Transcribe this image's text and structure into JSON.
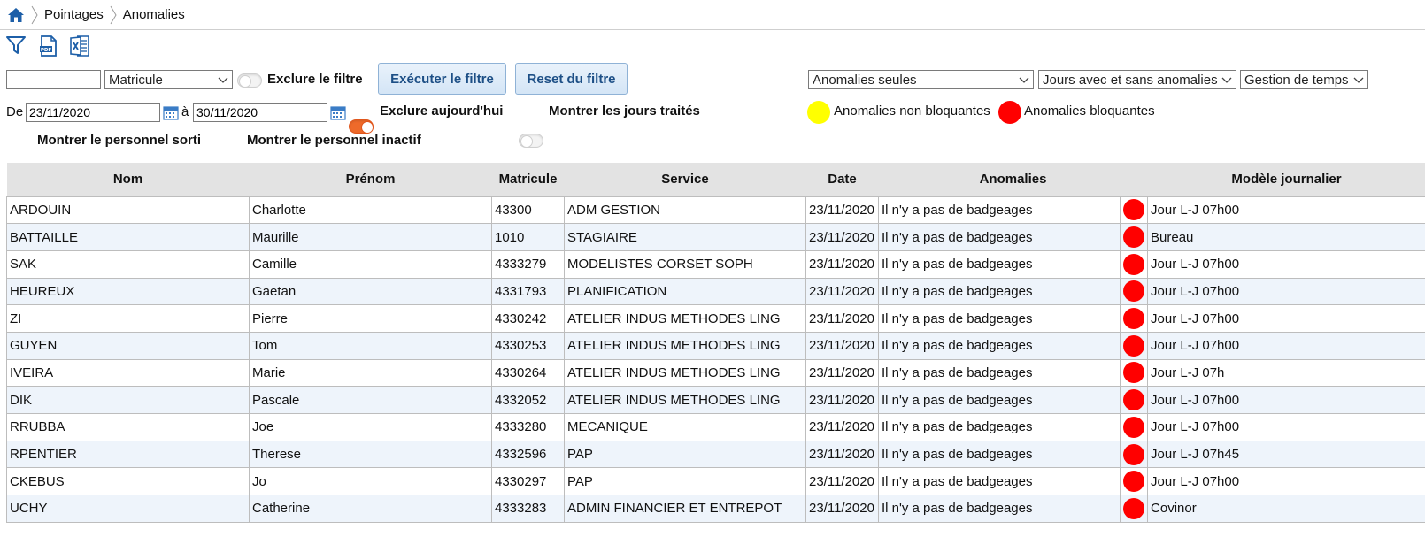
{
  "breadcrumb": {
    "items": [
      "Pointages",
      "Anomalies"
    ]
  },
  "toolbar": {
    "icons": [
      "filter-icon",
      "pdf-icon",
      "excel-icon"
    ]
  },
  "filter": {
    "text_value": "",
    "field_select": "Matricule",
    "exclude_filter_label": "Exclure le filtre",
    "run_button": "Exécuter le filtre",
    "reset_button": "Reset du filtre",
    "from_label": "De",
    "from_date": "23/11/2020",
    "to_label": "à",
    "to_date": "30/11/2020",
    "exclude_today_label": "Exclure aujourd'hui",
    "show_treated_label": "Montrer les jours traités",
    "show_left_label": "Montrer le personnel sorti",
    "show_inactive_label": "Montrer le personnel inactif",
    "anomaly_mode_select": "Anomalies seules",
    "days_select": "Jours avec et sans anomalies",
    "module_select": "Gestion de temps"
  },
  "legend": {
    "non_blocking_label": "Anomalies non bloquantes",
    "blocking_label": "Anomalies bloquantes",
    "non_blocking_color": "#ffff00",
    "blocking_color": "#ff0000"
  },
  "table": {
    "headers": [
      "Nom",
      "Prénom",
      "Matricule",
      "Service",
      "Date",
      "Anomalies",
      "Modèle journalier"
    ],
    "rows": [
      {
        "nom": "ARDOUIN",
        "prenom": "Charlotte",
        "matricule": "43300",
        "service": "ADM GESTION",
        "date": "23/11/2020",
        "anomalie": "Il n'y a pas de badgeages",
        "modele": "Jour L-J 07h00"
      },
      {
        "nom": "BATTAILLE",
        "prenom": "Maurille",
        "matricule": "1010",
        "service": "STAGIAIRE",
        "date": "23/11/2020",
        "anomalie": "Il n'y a pas de badgeages",
        "modele": "Bureau"
      },
      {
        "nom": "SAK",
        "prenom": "Camille",
        "matricule": "4333279",
        "service": "MODELISTES CORSET SOPH",
        "date": "23/11/2020",
        "anomalie": "Il n'y a pas de badgeages",
        "modele": "Jour L-J 07h00"
      },
      {
        "nom": "HEUREUX",
        "prenom": "Gaetan",
        "matricule": "4331793",
        "service": "PLANIFICATION",
        "date": "23/11/2020",
        "anomalie": "Il n'y a pas de badgeages",
        "modele": "Jour L-J 07h00"
      },
      {
        "nom": "ZI",
        "prenom": "Pierre",
        "matricule": "4330242",
        "service": "ATELIER INDUS METHODES LING",
        "date": "23/11/2020",
        "anomalie": "Il n'y a pas de badgeages",
        "modele": "Jour L-J 07h00"
      },
      {
        "nom": "GUYEN",
        "prenom": "Tom",
        "matricule": "4330253",
        "service": "ATELIER INDUS METHODES LING",
        "date": "23/11/2020",
        "anomalie": "Il n'y a pas de badgeages",
        "modele": "Jour L-J 07h00"
      },
      {
        "nom": "IVEIRA",
        "prenom": "Marie",
        "matricule": "4330264",
        "service": "ATELIER INDUS METHODES LING",
        "date": "23/11/2020",
        "anomalie": "Il n'y a pas de badgeages",
        "modele": "Jour L-J 07h"
      },
      {
        "nom": "DIK",
        "prenom": "Pascale",
        "matricule": "4332052",
        "service": "ATELIER INDUS METHODES LING",
        "date": "23/11/2020",
        "anomalie": "Il n'y a pas de badgeages",
        "modele": "Jour L-J 07h00"
      },
      {
        "nom": "RRUBBA",
        "prenom": "Joe",
        "matricule": "4333280",
        "service": "MECANIQUE",
        "date": "23/11/2020",
        "anomalie": "Il n'y a pas de badgeages",
        "modele": "Jour L-J 07h00"
      },
      {
        "nom": "RPENTIER",
        "prenom": "Therese",
        "matricule": "4332596",
        "service": "PAP",
        "date": "23/11/2020",
        "anomalie": "Il n'y a pas de badgeages",
        "modele": "Jour L-J 07h45"
      },
      {
        "nom": "CKEBUS",
        "prenom": "Jo",
        "matricule": "4330297",
        "service": "PAP",
        "date": "23/11/2020",
        "anomalie": "Il n'y a pas de badgeages",
        "modele": "Jour L-J 07h00"
      },
      {
        "nom": "UCHY",
        "prenom": "Catherine",
        "matricule": "4333283",
        "service": "ADMIN FINANCIER ET ENTREPOT",
        "date": "23/11/2020",
        "anomalie": "Il n'y a pas de badgeages",
        "modele": "Covinor"
      }
    ]
  }
}
